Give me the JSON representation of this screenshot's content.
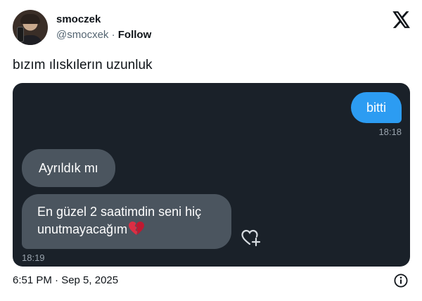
{
  "author": {
    "name": "smoczek",
    "handle": "@smocxek",
    "separator": "·",
    "follow_label": "Follow"
  },
  "tweet": {
    "text": "bızım ılıskılerın uzunluk",
    "timestamp": "6:51 PM · Sep 5, 2025"
  },
  "chat": {
    "outgoing": [
      {
        "text": "bitti",
        "time": "18:18"
      }
    ],
    "incoming": [
      {
        "text": "Ayrıldık mı"
      },
      {
        "text": "En güzel 2 saatimdin seni hiç unutmayacağım"
      }
    ],
    "incoming_time": "18:19"
  },
  "icons": {
    "logo": "x-logo-icon",
    "info": "info-icon",
    "react": "heart-plus-icon",
    "emoji": "broken-heart-icon"
  },
  "colors": {
    "outgoing_bubble": "#2c9cf2",
    "incoming_bubble": "#4b555f",
    "chat_background": "#1a2129"
  }
}
